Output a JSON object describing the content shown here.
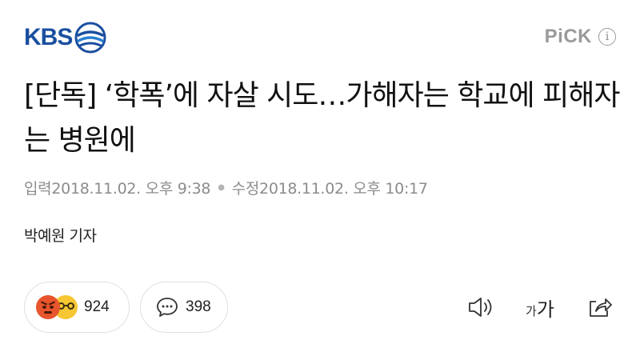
{
  "header": {
    "logo_text": "KBS",
    "pick_label": "PiCK",
    "info_glyph": "i"
  },
  "article": {
    "title": "[단독] ‘학폭’에 자살 시도…가해자는 학교에 피해자는 병원에",
    "published_label": "입력",
    "published_time": "2018.11.02. 오후 9:38",
    "updated_label": "수정",
    "updated_time": "2018.11.02. 오후 10:17",
    "reporter": "박예원 기자"
  },
  "actions": {
    "reaction_count": "924",
    "comment_count": "398",
    "font_small": "가",
    "font_large": "가"
  },
  "icons": {
    "logo": "kbs-swirl-icon",
    "info": "info-icon",
    "angry": "angry-emoji-icon",
    "glasses": "glasses-emoji-icon",
    "comment": "speech-bubble-icon",
    "audio": "speaker-icon",
    "font": "font-size-icon",
    "share": "share-icon"
  },
  "colors": {
    "brand_blue": "#1a4fa0",
    "pick_gray": "#9a9a9a",
    "meta_gray": "#8c8c8c",
    "angry_red": "#e8552c",
    "emoji_yellow": "#f6c733"
  }
}
